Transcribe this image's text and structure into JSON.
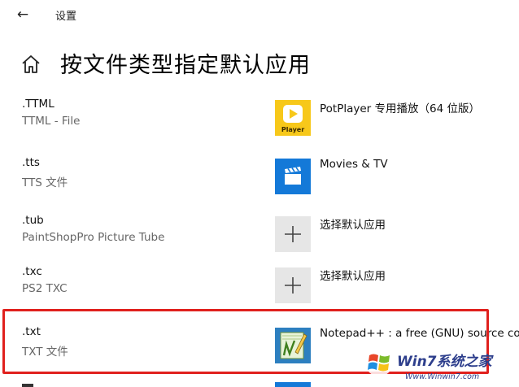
{
  "window": {
    "title": "设置"
  },
  "page": {
    "title": "按文件类型指定默认应用"
  },
  "rows": [
    {
      "ext": ".TTML",
      "desc": "TTML - File",
      "app": "PotPlayer 专用播放（64 位版）",
      "icon": "potplayer-icon",
      "icon_label": "Player"
    },
    {
      "ext": ".tts",
      "desc": "TTS 文件",
      "app": "Movies & TV",
      "icon": "movies-tv-icon"
    },
    {
      "ext": ".tub",
      "desc": "PaintShopPro Picture Tube",
      "app": "选择默认应用",
      "icon": "plus-icon"
    },
    {
      "ext": ".txc",
      "desc": "PS2 TXC",
      "app": "选择默认应用",
      "icon": "plus-icon"
    },
    {
      "ext": ".txt",
      "desc": "TXT 文件",
      "app": "Notepad++ : a free (GNU) source co",
      "icon": "notepad-plus-plus-icon"
    }
  ],
  "colors": {
    "highlight": "#e0201d",
    "potplayer": "#f7c81a",
    "movies": "#1479d8",
    "plus_tile": "#e6e6e6",
    "npp": "#2d7fc0"
  },
  "watermark": {
    "brand": "Win7系统之家",
    "url": "Www.Winwin7.com"
  }
}
